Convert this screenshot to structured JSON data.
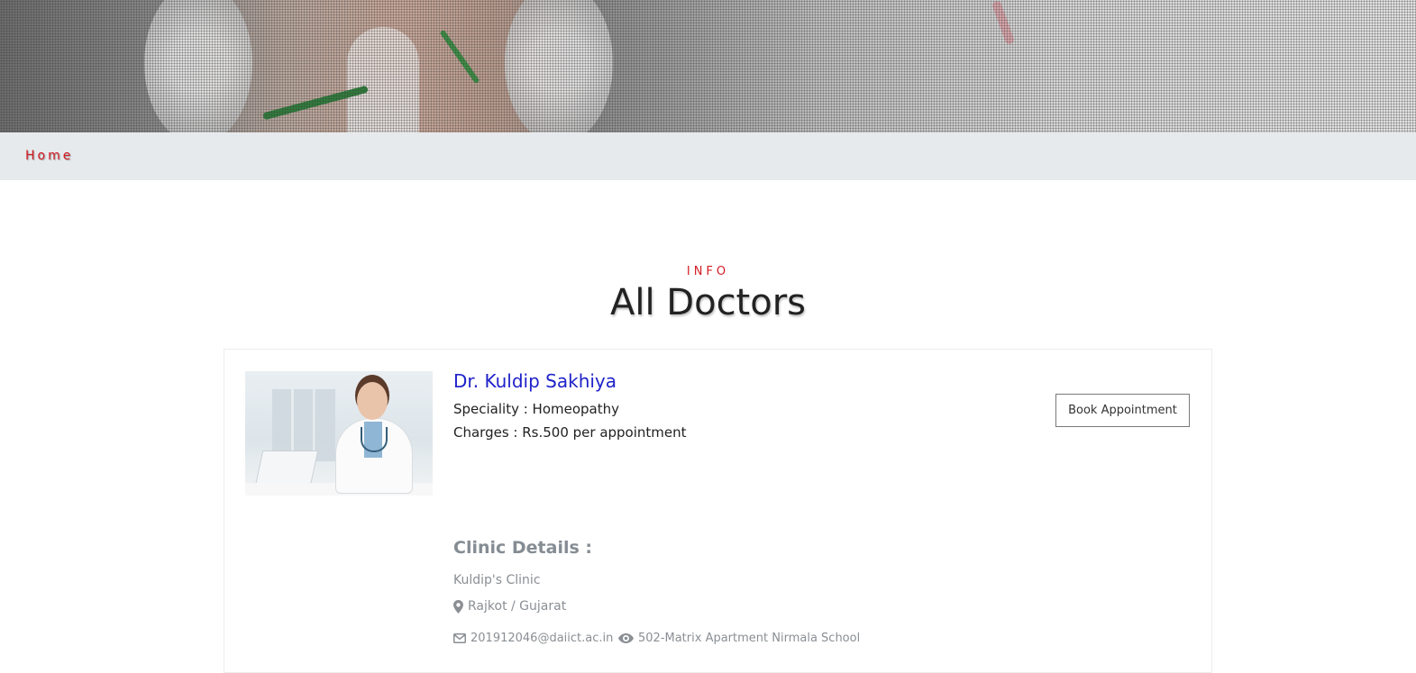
{
  "breadcrumb": {
    "home_label": "Home"
  },
  "section": {
    "eyebrow": "INFO",
    "title": "All Doctors"
  },
  "doctor": {
    "name": "Dr. Kuldip Sakhiya",
    "speciality": "Speciality : Homeopathy",
    "charges": "Charges : Rs.500 per appointment",
    "book_button_label": "Book Appointment"
  },
  "clinic": {
    "heading": "Clinic Details :",
    "name": "Kuldip's Clinic",
    "location": "Rajkot / Gujarat",
    "email": "201912046@daiict.ac.in",
    "address": "502-Matrix Apartment Nirmala School"
  },
  "icons": {
    "location": "map-marker-icon",
    "email": "envelope-icon",
    "address": "eye-icon"
  },
  "colors": {
    "accent_red": "#d31c24",
    "doctor_name_blue": "#1f22c9",
    "muted_text": "#8a8f94",
    "breadcrumb_bg": "#e7eaed"
  }
}
